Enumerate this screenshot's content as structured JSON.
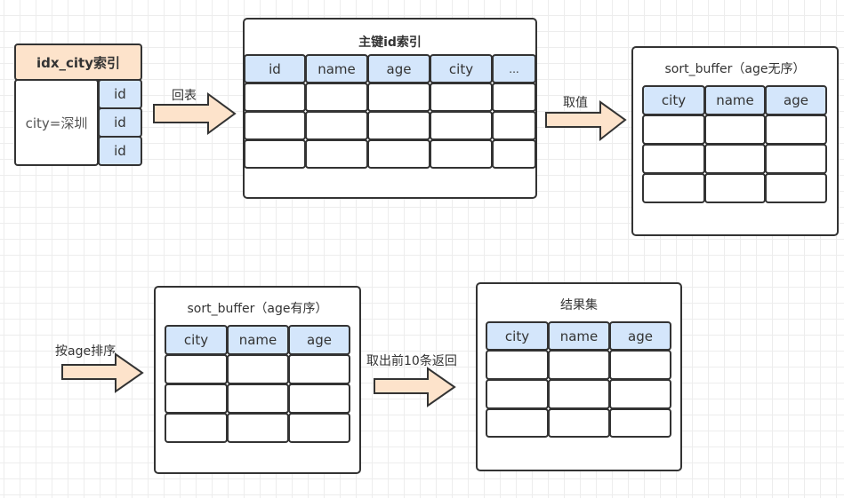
{
  "colors": {
    "header_fill": "#d4e6fb",
    "index_header_fill": "#fde3cb",
    "arrow_fill": "#fde3cb",
    "stroke": "#333333",
    "grid": "#ededed"
  },
  "idx_city": {
    "title": "idx_city索引",
    "key_label": "city=深圳",
    "ids": [
      "id",
      "id",
      "id"
    ]
  },
  "arrows": {
    "a1": "回表",
    "a2": "取值",
    "a3": "按age排序",
    "a4": "取出前10条返回"
  },
  "primary_index": {
    "title": "主键id索引",
    "columns": [
      "id",
      "name",
      "age",
      "city",
      "..."
    ]
  },
  "sort_buffer_unsorted": {
    "title": "sort_buffer（age无序）",
    "columns": [
      "city",
      "name",
      "age"
    ]
  },
  "sort_buffer_sorted": {
    "title": "sort_buffer（age有序）",
    "columns": [
      "city",
      "name",
      "age"
    ]
  },
  "result_set": {
    "title": "结果集",
    "columns": [
      "city",
      "name",
      "age"
    ]
  }
}
